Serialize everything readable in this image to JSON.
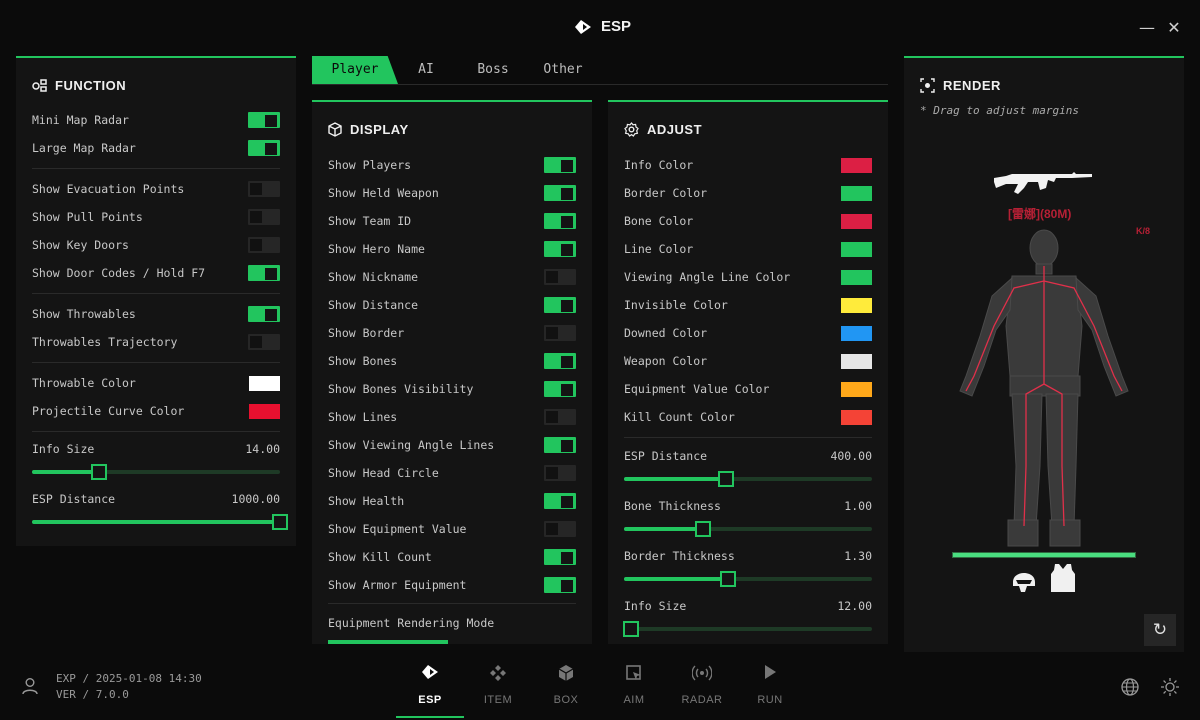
{
  "window": {
    "title": "ESP",
    "minimize": "—",
    "close": "✕"
  },
  "tabs": [
    {
      "label": "Player",
      "active": true
    },
    {
      "label": "AI",
      "active": false
    },
    {
      "label": "Boss",
      "active": false
    },
    {
      "label": "Other",
      "active": false
    }
  ],
  "function_panel": {
    "title": "FUNCTION",
    "toggles": [
      {
        "label": "Mini Map Radar",
        "on": true
      },
      {
        "label": "Large Map Radar",
        "on": true
      },
      {
        "label": "Show Evacuation Points",
        "on": false
      },
      {
        "label": "Show Pull Points",
        "on": false
      },
      {
        "label": "Show Key Doors",
        "on": false
      },
      {
        "label": "Show Door Codes / Hold F7",
        "on": true
      },
      {
        "label": "Show Throwables",
        "on": true
      },
      {
        "label": "Throwables Trajectory",
        "on": false
      }
    ],
    "colors": [
      {
        "label": "Throwable Color",
        "color": "#ffffff"
      },
      {
        "label": "Projectile Curve Color",
        "color": "#e8102f"
      }
    ],
    "sliders": [
      {
        "label": "Info Size",
        "value": "14.00",
        "fraction": 0.27
      },
      {
        "label": "ESP Distance",
        "value": "1000.00",
        "fraction": 1.0
      }
    ]
  },
  "display_panel": {
    "title": "DISPLAY",
    "toggles": [
      {
        "label": "Show Players",
        "on": true
      },
      {
        "label": "Show Held Weapon",
        "on": true
      },
      {
        "label": "Show Team ID",
        "on": true
      },
      {
        "label": "Show Hero Name",
        "on": true
      },
      {
        "label": "Show Nickname",
        "on": false
      },
      {
        "label": "Show Distance",
        "on": true
      },
      {
        "label": "Show Border",
        "on": false
      },
      {
        "label": "Show Bones",
        "on": true
      },
      {
        "label": "Show Bones Visibility",
        "on": true
      },
      {
        "label": "Show Lines",
        "on": false
      },
      {
        "label": "Show Viewing Angle Lines",
        "on": true
      },
      {
        "label": "Show Head Circle",
        "on": false
      },
      {
        "label": "Show Health",
        "on": true
      },
      {
        "label": "Show Equipment Value",
        "on": false
      },
      {
        "label": "Show Kill Count",
        "on": true
      },
      {
        "label": "Show Armor Equipment",
        "on": true
      }
    ],
    "mode_label": "Equipment Rendering Mode"
  },
  "adjust_panel": {
    "title": "ADJUST",
    "colors": [
      {
        "label": "Info Color",
        "color": "#dc1f44"
      },
      {
        "label": "Border Color",
        "color": "#22c55e"
      },
      {
        "label": "Bone Color",
        "color": "#dc1f44"
      },
      {
        "label": "Line Color",
        "color": "#22c55e"
      },
      {
        "label": "Viewing Angle Line Color",
        "color": "#22c55e"
      },
      {
        "label": "Invisible Color",
        "color": "#ffeb3b"
      },
      {
        "label": "Downed Color",
        "color": "#2196f3"
      },
      {
        "label": "Weapon Color",
        "color": "#e6e6e6"
      },
      {
        "label": "Equipment Value Color",
        "color": "#ffa81a"
      },
      {
        "label": "Kill Count Color",
        "color": "#f44336"
      }
    ],
    "sliders": [
      {
        "label": "ESP Distance",
        "value": "400.00",
        "fraction": 0.41
      },
      {
        "label": "Bone Thickness",
        "value": "1.00",
        "fraction": 0.32
      },
      {
        "label": "Border Thickness",
        "value": "1.30",
        "fraction": 0.42
      },
      {
        "label": "Info Size",
        "value": "12.00",
        "fraction": 0.03
      }
    ]
  },
  "render_panel": {
    "title": "RENDER",
    "hint": "* Drag to adjust margins",
    "info_text": "[雷娜](80M)",
    "kd_text": "K/8",
    "health": 1.0,
    "reset_icon": "↻"
  },
  "status": {
    "exp": "EXP / 2025-01-08 14:30",
    "ver": "VER / 7.0.0"
  },
  "bottom_nav": [
    {
      "label": "ESP",
      "icon": "esp-icon",
      "active": true
    },
    {
      "label": "ITEM",
      "icon": "item-icon",
      "active": false
    },
    {
      "label": "BOX",
      "icon": "box-icon",
      "active": false
    },
    {
      "label": "AIM",
      "icon": "aim-icon",
      "active": false
    },
    {
      "label": "RADAR",
      "icon": "radar-icon",
      "active": false
    },
    {
      "label": "RUN",
      "icon": "run-icon",
      "active": false
    }
  ],
  "icons": {
    "globe": "globe-icon",
    "theme": "sun-icon",
    "user": "user-icon"
  }
}
